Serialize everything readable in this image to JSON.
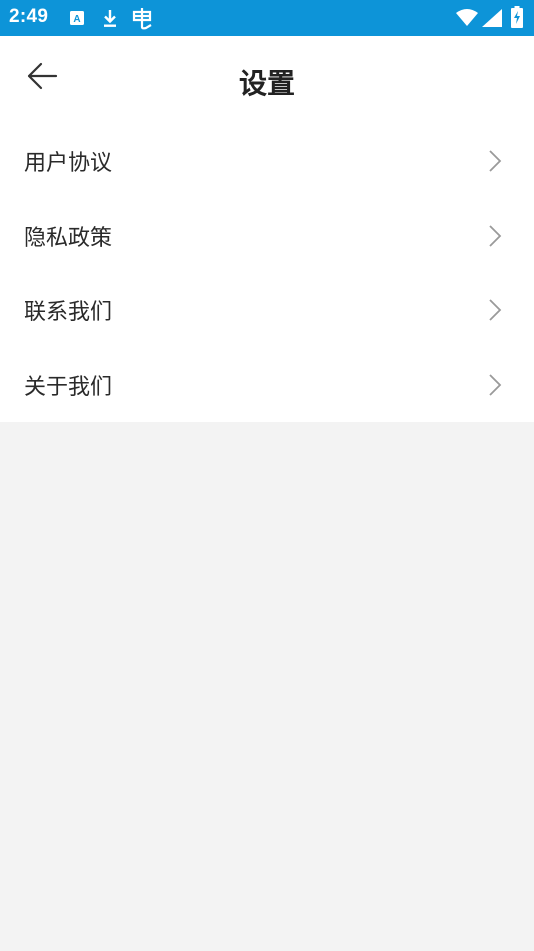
{
  "status_bar": {
    "time": "2:49",
    "icons": [
      "a-notification-icon",
      "download-icon",
      "bug-icon",
      "wifi-icon",
      "cell-signal-icon",
      "battery-charging-icon"
    ]
  },
  "header": {
    "title": "设置",
    "back_icon": "arrow-left-icon"
  },
  "menu": {
    "items": [
      {
        "label": "用户协议",
        "icon": "chevron-right-icon"
      },
      {
        "label": "隐私政策",
        "icon": "chevron-right-icon"
      },
      {
        "label": "联系我们",
        "icon": "chevron-right-icon"
      },
      {
        "label": "关于我们",
        "icon": "chevron-right-icon"
      }
    ]
  },
  "colors": {
    "status_bar": "#0d94d8",
    "page_background": "#f3f3f3",
    "surface": "#ffffff",
    "text_primary": "#2a2a2a",
    "chevron": "#9a9a9a"
  }
}
